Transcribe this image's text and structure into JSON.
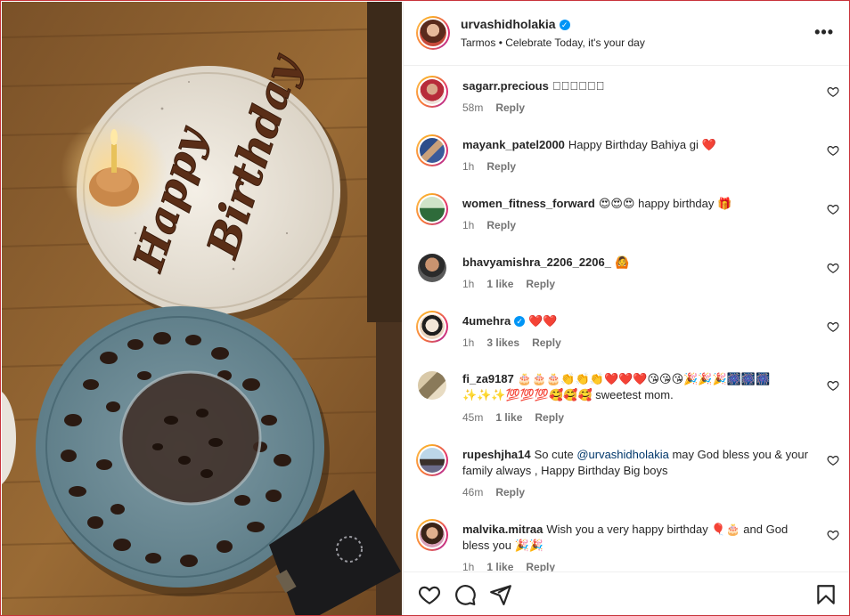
{
  "post": {
    "username": "urvashidholakia",
    "verified": true,
    "location": "Tarmos",
    "separator": "•",
    "audio": "Celebrate Today, it's your day",
    "more_icon": "more-horizontal-icon",
    "more_label": "•••"
  },
  "photo": {
    "plate_text_line1": "Happy",
    "plate_text_line2": "Birthday"
  },
  "comments": [
    {
      "username": "sagarr.precious",
      "text": "󰀀󰀀󰀀󰀀󰀀󰀀",
      "time": "58m",
      "likes": "",
      "reply": "Reply"
    },
    {
      "username": "mayank_patel2000",
      "text": "Happy Birthday Bahiya gi ❤️",
      "time": "1h",
      "likes": "",
      "reply": "Reply"
    },
    {
      "username": "women_fitness_forward",
      "text": "😍😍😍 happy birthday 🎁",
      "time": "1h",
      "likes": "",
      "reply": "Reply"
    },
    {
      "username": "bhavyamishra_2206_2206_",
      "text": "🙆",
      "time": "1h",
      "likes": "1 like",
      "reply": "Reply"
    },
    {
      "username": "4umehra",
      "verified": true,
      "text": "❤️❤️",
      "time": "1h",
      "likes": "3 likes",
      "reply": "Reply"
    },
    {
      "username": "fi_za9187",
      "text": "🎂🎂🎂👏👏👏❤️❤️❤️😘😘😘🎉🎉🎉🎆🎆🎆✨✨✨💯💯💯🥰🥰🥰 sweetest mom.",
      "time": "45m",
      "likes": "1 like",
      "reply": "Reply"
    },
    {
      "username": "rupeshjha14",
      "text_before": "So cute",
      "mention": "@urvashidholakia",
      "text_after": "may God bless you & your family always , Happy Birthday Big boys",
      "time": "46m",
      "likes": "",
      "reply": "Reply"
    },
    {
      "username": "malvika.mitraa",
      "text": "Wish you a very happy birthday 🎈🎂 and God bless you 🎉🎉",
      "time": "1h",
      "likes": "1 like",
      "reply": "Reply"
    }
  ],
  "actions": {
    "like_icon": "heart-icon",
    "comment_icon": "comment-icon",
    "share_icon": "share-icon",
    "save_icon": "bookmark-icon"
  },
  "colors": {
    "accent_blue": "#0095f6",
    "heart_red": "#e0245e",
    "border": "#c8323a"
  }
}
